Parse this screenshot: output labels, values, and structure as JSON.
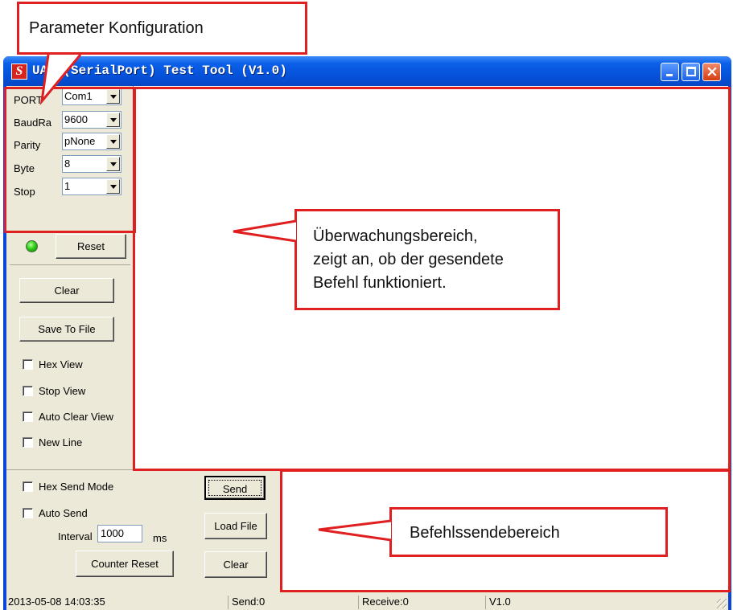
{
  "annotations": {
    "parameter_config": "Parameter Konfiguration",
    "monitor_lines": [
      "Überwachungsbereich,",
      "zeigt an, ob der gesendete",
      "Befehl funktioniert."
    ],
    "send_area": "Befehlssendebereich"
  },
  "window": {
    "title": "UART(SerialPort) Test Tool (V1.0)",
    "icon_glyph": "S"
  },
  "params": {
    "port": {
      "label": "PORT",
      "value": "Com1"
    },
    "baud": {
      "label": "BaudRa",
      "value": "9600"
    },
    "parity": {
      "label": "Parity",
      "value": "pNone"
    },
    "byte": {
      "label": "Byte",
      "value": "8"
    },
    "stop": {
      "label": "Stop",
      "value": "1"
    }
  },
  "buttons": {
    "reset": "Reset",
    "clear_view": "Clear",
    "save_to_file": "Save To File",
    "send": "Send",
    "load_file": "Load File",
    "counter_reset": "Counter Reset",
    "clear_send": "Clear"
  },
  "view_options": {
    "hex_view": "Hex View",
    "stop_view": "Stop View",
    "auto_clear_view": "Auto Clear View",
    "new_line": "New Line"
  },
  "send_options": {
    "hex_send_mode": "Hex Send Mode",
    "auto_send": "Auto Send",
    "interval_label": "Interval",
    "interval_value": "1000",
    "interval_unit": "ms"
  },
  "status": {
    "datetime": "2013-05-08 14:03:35",
    "send": "Send:0",
    "receive": "Receive:0",
    "version": "V1.0"
  },
  "colors": {
    "annotation_red": "#e02020",
    "titlebar_blue": "#0550d8",
    "led_green": "#2fcf18"
  }
}
